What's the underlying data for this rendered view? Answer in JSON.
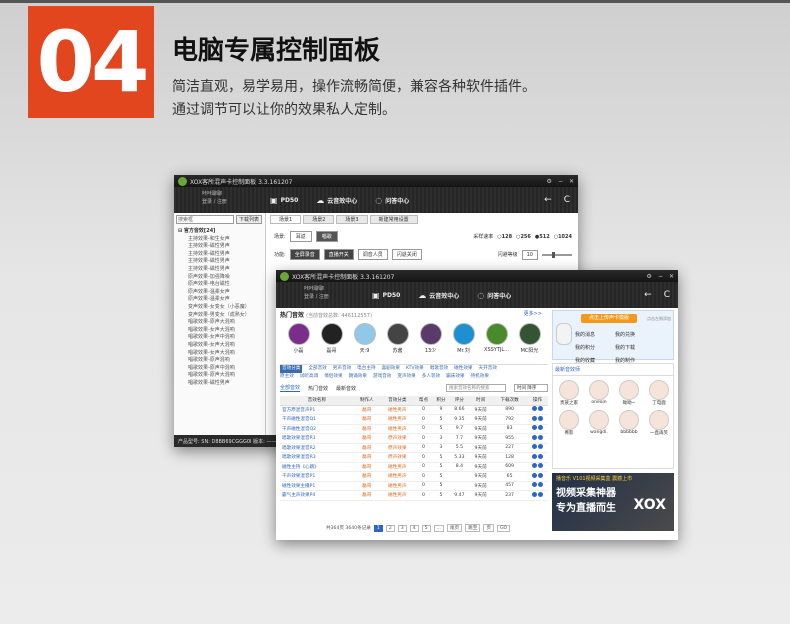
{
  "badge": "04",
  "headline": "电脑专属控制面板",
  "desc": [
    "简洁直观，易学易用，操作流畅简便，兼容各种软件插件。",
    "通过调节可以让你的效果私人定制。"
  ],
  "app": {
    "title": "XOX客所混声卡控制面板  3.3.161207",
    "user_line1": "咔咔聊聊",
    "user_line2": "登录 / 注册",
    "tabs": [
      "PD50",
      "云音效中心",
      "问答中心"
    ],
    "nav_back": "←",
    "nav_refresh": "C"
  },
  "back": {
    "search_placeholder": "搜索框",
    "search_btn": "下载列表",
    "tree_root": "⊟ 官方音效[24]",
    "tree_items": [
      "主持效果-和生女声",
      "主持效果-磁性男声",
      "主持效果-磁性男声",
      "主持效果-磁性男声",
      "主持效果-磁性男声",
      "原声效果-加强降噪",
      "原声效果-电台磁性",
      "原声效果-温柔女声",
      "原声效果-温柔女声",
      "变声效果-女变女（小恶魔）",
      "变声效果-男变女（成熟女）",
      "唱歌效果-原声大混响",
      "唱歌效果-女声大混响",
      "唱歌效果-女声中混响",
      "唱歌效果-女声大混响",
      "唱歌效果-女声大混响",
      "唱歌效果-原声混响",
      "唱歌效果-原声中混响",
      "唱歌效果-原声大混响",
      "唱歌效果-磁性男声"
    ],
    "statusbar": "产品型号: SN: D8BB69CGGG0I  版本: ——",
    "session_tabs": [
      "场景1",
      "场景2",
      "场景3",
      "新建常用设置"
    ],
    "scene_label": "场景:",
    "scene_btn1": "耳返",
    "scene_btn2": "唱歌",
    "sample_label": "采样速率",
    "sample_opts": [
      "128",
      "256",
      "512",
      "1024"
    ],
    "func_label": "功能:",
    "func_btns": [
      "全屏录音",
      "直播开关",
      "调音人员",
      "闪退关闭"
    ],
    "gate_label": "闪避等级",
    "gate_value": "10"
  },
  "front": {
    "hot_title": "热门音效",
    "hot_sub": "(当前音效总数: 446112557)",
    "more": "更多>>",
    "avatars": [
      "小磊",
      "磊哥",
      "天:9",
      "苏酱",
      "13少",
      "Mr.刘",
      "XSSYTJL...",
      "MC阳光"
    ],
    "cat_rows": [
      [
        "音效分类",
        "全部音效",
        "男声音效",
        "电台主持",
        "喜剧效果",
        "KTV效果",
        "唱歌音效",
        "磁性效果",
        "天开音效"
      ],
      [
        "",
        "原主效",
        "试听高调",
        "情侣效果",
        "朗诵效果",
        "游戏音效",
        "变声效果",
        "多人装效",
        "蹦床效果",
        "待机效果"
      ]
    ],
    "sub_tabs": [
      "全部音效",
      "热门音效",
      "最新音效"
    ],
    "search_ph": "搜索音效名称的搜索",
    "sort": "时间 降序",
    "columns": [
      "音效名称",
      "制作人",
      "音效分类",
      "帮点",
      "积分",
      "评分",
      "时间",
      "下载次数",
      "操作"
    ],
    "rows": [
      [
        "官方原混音声P1",
        "磊哥",
        "磁性男声",
        "0",
        "9",
        "8.66",
        "9天前",
        "890"
      ],
      [
        "干声磁性混音Q1",
        "磊哥",
        "磁性男声",
        "0",
        "5",
        "9.35",
        "9天前",
        "792"
      ],
      [
        "干声磁性混音Q2",
        "磊哥",
        "磁性男声",
        "0",
        "5",
        "9.7",
        "9天前",
        "83"
      ],
      [
        "唱歌效果混音R1",
        "磊哥",
        "原声效果",
        "0",
        "3",
        "7.7",
        "9天前",
        "955"
      ],
      [
        "唱歌效果混音R2",
        "磊哥",
        "原声效果",
        "0",
        "3",
        "5.5",
        "9天前",
        "227"
      ],
      [
        "唱歌效果混音R3",
        "磊哥",
        "原声效果",
        "0",
        "5",
        "5.33",
        "9天前",
        "128"
      ],
      [
        "磁性主持《心跳》",
        "磊哥",
        "磁性男声",
        "0",
        "5",
        "8.4",
        "9天前",
        "609"
      ],
      [
        "干声效果混音P1",
        "磊哥",
        "磁性男声",
        "0",
        "5",
        "",
        "9天前",
        "65"
      ],
      [
        "磁性效果主播P1",
        "磊哥",
        "磁性男声",
        "0",
        "5",
        "",
        "9天前",
        "457"
      ],
      [
        "霸气主声效果P4",
        "磊哥",
        "磁性男声",
        "0",
        "5",
        "9.47",
        "9天前",
        "237"
      ]
    ],
    "pager": [
      "共364页  3640条记录",
      "1",
      "2",
      "3",
      "4",
      "5",
      "...",
      "尾页",
      "跳至",
      "页",
      "GO"
    ],
    "r_btn": "点击上传声卡模版",
    "r_note": "点击左侧添加",
    "r_links": [
      "我的消息",
      "我的兑换",
      "我的积分",
      "我的下载",
      "我的收藏",
      "我的制作"
    ],
    "r_title": "最新音效师",
    "r_people": [
      "贵族之家",
      "oneoin",
      "呦呦~",
      "丁电鹿",
      "菁影",
      "wangdi.",
      "bbbbbb",
      "一直再笑"
    ],
    "ad_top": "播音乐 V101视频采集盒  震撼上市",
    "ad_l1": "视频采集神器",
    "ad_l2": "专为直播而生",
    "ad_logo": "XOX"
  }
}
